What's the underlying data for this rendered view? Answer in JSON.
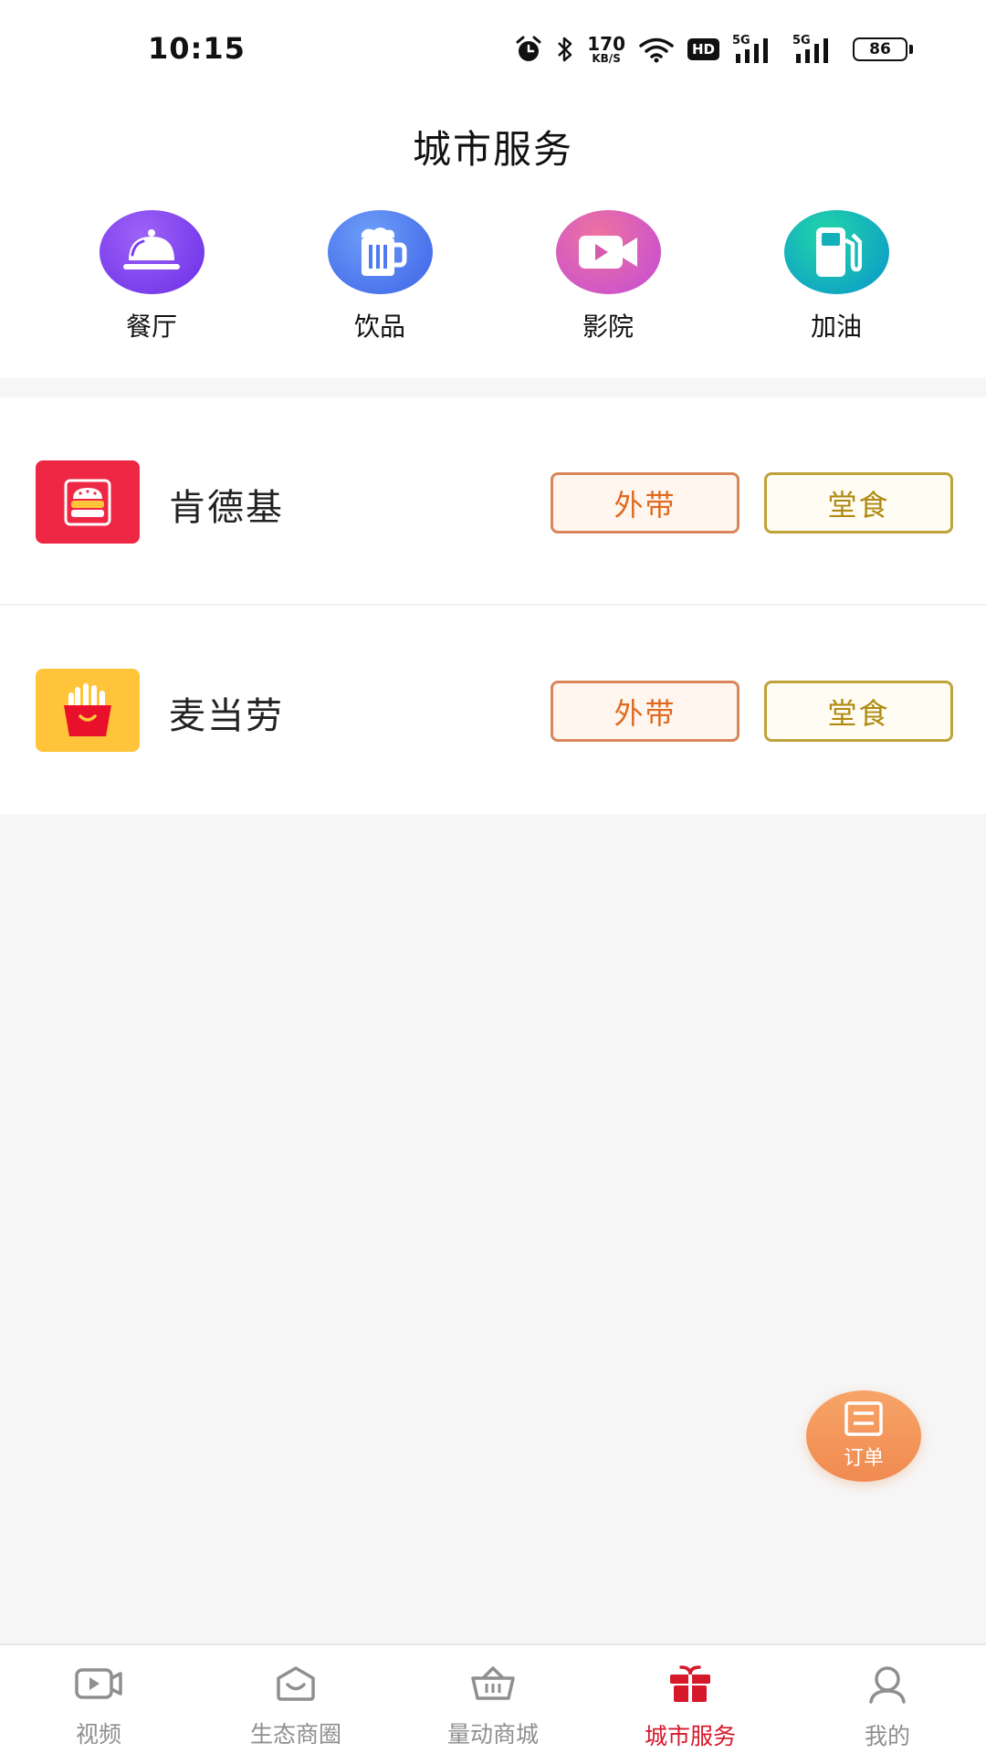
{
  "status_bar": {
    "time": "10:15",
    "net_speed_value": "170",
    "net_speed_unit": "KB/S",
    "hd_label": "HD",
    "sim1_label": "5G",
    "sim2_label": "5G",
    "battery": "86",
    "icons": [
      "alarm-icon",
      "bluetooth-icon",
      "wifi-icon",
      "signal-icon",
      "battery-icon"
    ]
  },
  "header": {
    "title": "城市服务"
  },
  "categories": [
    {
      "label": "餐厅",
      "icon": "cloche-icon",
      "color": "#7a3cf0"
    },
    {
      "label": "饮品",
      "icon": "beer-mug-icon",
      "color": "#4f7bf0"
    },
    {
      "label": "影院",
      "icon": "video-camera-icon",
      "color": "#d55ab0"
    },
    {
      "label": "加油",
      "icon": "fuel-pump-icon",
      "color": "#12b0b8"
    }
  ],
  "stores": [
    {
      "name": "肯德基",
      "logo": "burger-icon",
      "logo_color": "#ee2844",
      "takeout_label": "外带",
      "dinein_label": "堂食"
    },
    {
      "name": "麦当劳",
      "logo": "fries-icon",
      "logo_color": "#ffc43a",
      "takeout_label": "外带",
      "dinein_label": "堂食"
    }
  ],
  "fab": {
    "label": "订单",
    "icon": "order-list-icon"
  },
  "bottom_nav": {
    "active_index": 3,
    "active_color": "#d6182b",
    "items": [
      {
        "label": "视频",
        "icon": "video-icon"
      },
      {
        "label": "生态商圈",
        "icon": "shop-bag-icon"
      },
      {
        "label": "量动商城",
        "icon": "basket-icon"
      },
      {
        "label": "城市服务",
        "icon": "gift-icon"
      },
      {
        "label": "我的",
        "icon": "user-icon"
      }
    ]
  }
}
